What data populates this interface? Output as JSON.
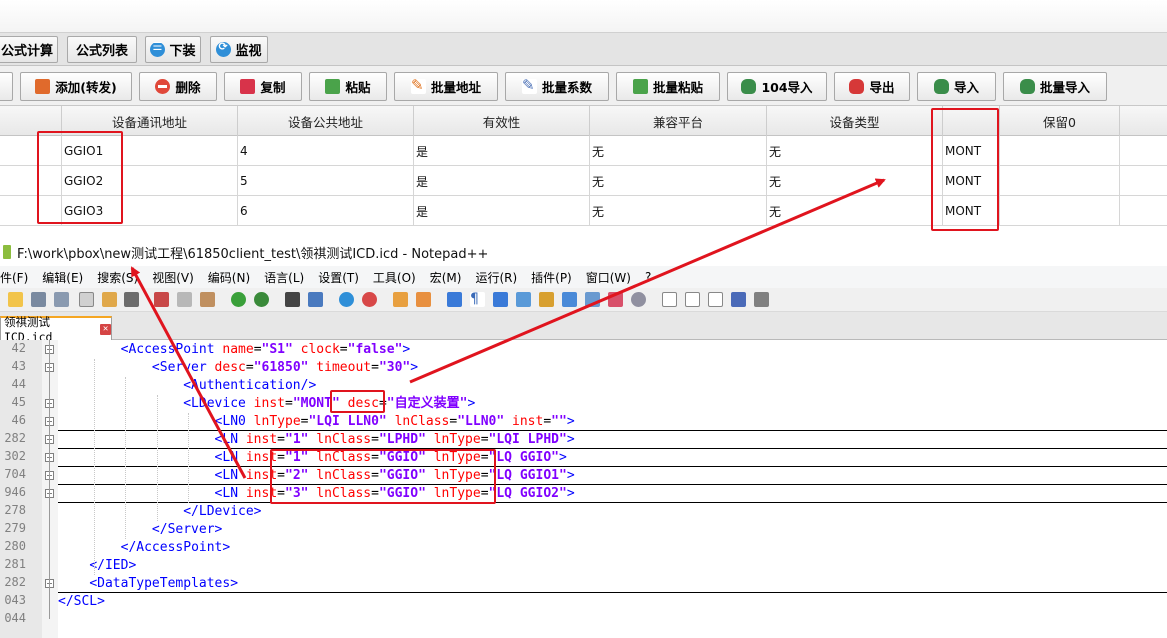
{
  "app": {
    "tabs": [
      {
        "label": "公式计算",
        "icon": ""
      },
      {
        "label": "公式列表",
        "icon": ""
      },
      {
        "label": "下装",
        "icon": "list-icon"
      },
      {
        "label": "监视",
        "icon": "monitor-icon"
      }
    ],
    "toolbar": [
      {
        "label": "添加(转发)",
        "icon": "add-icon"
      },
      {
        "label": "删除",
        "icon": "delete-icon"
      },
      {
        "label": "复制",
        "icon": "copy-icon"
      },
      {
        "label": "粘贴",
        "icon": "paste-icon"
      },
      {
        "label": "批量地址",
        "icon": "edit-address-icon"
      },
      {
        "label": "批量系数",
        "icon": "edit-coefficient-icon"
      },
      {
        "label": "批量粘贴",
        "icon": "batch-paste-icon"
      },
      {
        "label": "104导入",
        "icon": "database-import-icon"
      },
      {
        "label": "导出",
        "icon": "database-export-icon"
      },
      {
        "label": "导入",
        "icon": "database-import-icon"
      },
      {
        "label": "批量导入",
        "icon": "database-batch-import-icon"
      }
    ],
    "grid": {
      "columns": [
        "设备通讯地址",
        "设备公共地址",
        "有效性",
        "兼容平台",
        "设备类型",
        "",
        "保留0"
      ],
      "rows": [
        [
          "GGIO1",
          "4",
          "是",
          "无",
          "无",
          "MONT",
          ""
        ],
        [
          "GGIO2",
          "5",
          "是",
          "无",
          "无",
          "MONT",
          ""
        ],
        [
          "GGIO3",
          "6",
          "是",
          "无",
          "无",
          "MONT",
          ""
        ]
      ]
    }
  },
  "notepad": {
    "title": "F:\\work\\pbox\\new测试工程\\61850client_test\\领祺测试ICD.icd - Notepad++",
    "menu": [
      "件(F)",
      "编辑(E)",
      "搜索(S)",
      "视图(V)",
      "编码(N)",
      "语言(L)",
      "设置(T)",
      "工具(O)",
      "宏(M)",
      "运行(R)",
      "插件(P)",
      "窗口(W)",
      "?"
    ],
    "tab_label": "领祺测试ICD.icd",
    "lines": [
      {
        "num": "42",
        "indent": 8,
        "parts": [
          [
            "tag",
            "<AccessPoint"
          ],
          [
            "attr",
            " name"
          ],
          [
            "eq",
            "="
          ],
          [
            "val",
            "\"S1\""
          ],
          [
            "attr",
            " clock"
          ],
          [
            "eq",
            "="
          ],
          [
            "val",
            "\"false\""
          ],
          [
            "tag",
            ">"
          ]
        ]
      },
      {
        "num": "43",
        "indent": 12,
        "parts": [
          [
            "tag",
            "<Server"
          ],
          [
            "attr",
            " desc"
          ],
          [
            "eq",
            "="
          ],
          [
            "val",
            "\"61850\""
          ],
          [
            "attr",
            " timeout"
          ],
          [
            "eq",
            "="
          ],
          [
            "val",
            "\"30\""
          ],
          [
            "tag",
            ">"
          ]
        ]
      },
      {
        "num": "44",
        "indent": 16,
        "parts": [
          [
            "tag",
            "<Authentication/>"
          ]
        ]
      },
      {
        "num": "45",
        "indent": 16,
        "parts": [
          [
            "tag",
            "<LDevice"
          ],
          [
            "attr",
            " inst"
          ],
          [
            "eq",
            "="
          ],
          [
            "val",
            "\"MONT\""
          ],
          [
            "attr",
            " desc"
          ],
          [
            "eq",
            "="
          ],
          [
            "val",
            "\""
          ],
          [
            "cn",
            "自定义装置"
          ],
          [
            "val",
            "\""
          ],
          [
            "tag",
            ">"
          ]
        ]
      },
      {
        "num": "46",
        "indent": 20,
        "parts": [
          [
            "tag",
            "<LN0"
          ],
          [
            "attr",
            " lnType"
          ],
          [
            "eq",
            "="
          ],
          [
            "val",
            "\"LQI LLN0\""
          ],
          [
            "attr",
            " lnClass"
          ],
          [
            "eq",
            "="
          ],
          [
            "val",
            "\"LLN0\""
          ],
          [
            "attr",
            " inst"
          ],
          [
            "eq",
            "="
          ],
          [
            "val",
            "\"\""
          ],
          [
            "tag",
            ">"
          ]
        ]
      },
      {
        "num": "282",
        "indent": 20,
        "parts": [
          [
            "tag",
            "<LN"
          ],
          [
            "attr",
            " inst"
          ],
          [
            "eq",
            "="
          ],
          [
            "val",
            "\"1\""
          ],
          [
            "attr",
            " lnClass"
          ],
          [
            "eq",
            "="
          ],
          [
            "val",
            "\"LPHD\""
          ],
          [
            "attr",
            " lnType"
          ],
          [
            "eq",
            "="
          ],
          [
            "val",
            "\"LQI LPHD\""
          ],
          [
            "tag",
            ">"
          ]
        ]
      },
      {
        "num": "302",
        "indent": 20,
        "parts": [
          [
            "tag",
            "<LN"
          ],
          [
            "attr",
            " inst"
          ],
          [
            "eq",
            "="
          ],
          [
            "val",
            "\"1\""
          ],
          [
            "attr",
            " lnClass"
          ],
          [
            "eq",
            "="
          ],
          [
            "val",
            "\"GGIO\""
          ],
          [
            "attr",
            " lnType"
          ],
          [
            "eq",
            "="
          ],
          [
            "val",
            "\"LQ GGIO\""
          ],
          [
            "tag",
            ">"
          ]
        ]
      },
      {
        "num": "704",
        "indent": 20,
        "parts": [
          [
            "tag",
            "<LN"
          ],
          [
            "attr",
            " inst"
          ],
          [
            "eq",
            "="
          ],
          [
            "val",
            "\"2\""
          ],
          [
            "attr",
            " lnClass"
          ],
          [
            "eq",
            "="
          ],
          [
            "val",
            "\"GGIO\""
          ],
          [
            "attr",
            " lnType"
          ],
          [
            "eq",
            "="
          ],
          [
            "val",
            "\"LQ GGIO1\""
          ],
          [
            "tag",
            ">"
          ]
        ]
      },
      {
        "num": "946",
        "indent": 20,
        "parts": [
          [
            "tag",
            "<LN"
          ],
          [
            "attr",
            " inst"
          ],
          [
            "eq",
            "="
          ],
          [
            "val",
            "\"3\""
          ],
          [
            "attr",
            " lnClass"
          ],
          [
            "eq",
            "="
          ],
          [
            "val",
            "\"GGIO\""
          ],
          [
            "attr",
            " lnType"
          ],
          [
            "eq",
            "="
          ],
          [
            "val",
            "\"LQ GGIO2\""
          ],
          [
            "tag",
            ">"
          ]
        ]
      },
      {
        "num": "278",
        "indent": 16,
        "parts": [
          [
            "tag",
            "</LDevice>"
          ]
        ]
      },
      {
        "num": "279",
        "indent": 12,
        "parts": [
          [
            "tag",
            "</Server>"
          ]
        ]
      },
      {
        "num": "280",
        "indent": 8,
        "parts": [
          [
            "tag",
            "</AccessPoint>"
          ]
        ]
      },
      {
        "num": "281",
        "indent": 4,
        "parts": [
          [
            "tag",
            "</IED>"
          ]
        ]
      },
      {
        "num": "282",
        "indent": 4,
        "parts": [
          [
            "tag",
            "<DataTypeTemplates>"
          ]
        ]
      },
      {
        "num": "043",
        "indent": 0,
        "parts": [
          [
            "tag",
            "</SCL>"
          ]
        ]
      },
      {
        "num": "044",
        "indent": 0,
        "parts": []
      }
    ]
  },
  "colors": {
    "annotation_red": "#e0141e",
    "xml_tag": "#0000ff",
    "xml_attr": "#ff0000",
    "xml_value": "#8000ff"
  }
}
